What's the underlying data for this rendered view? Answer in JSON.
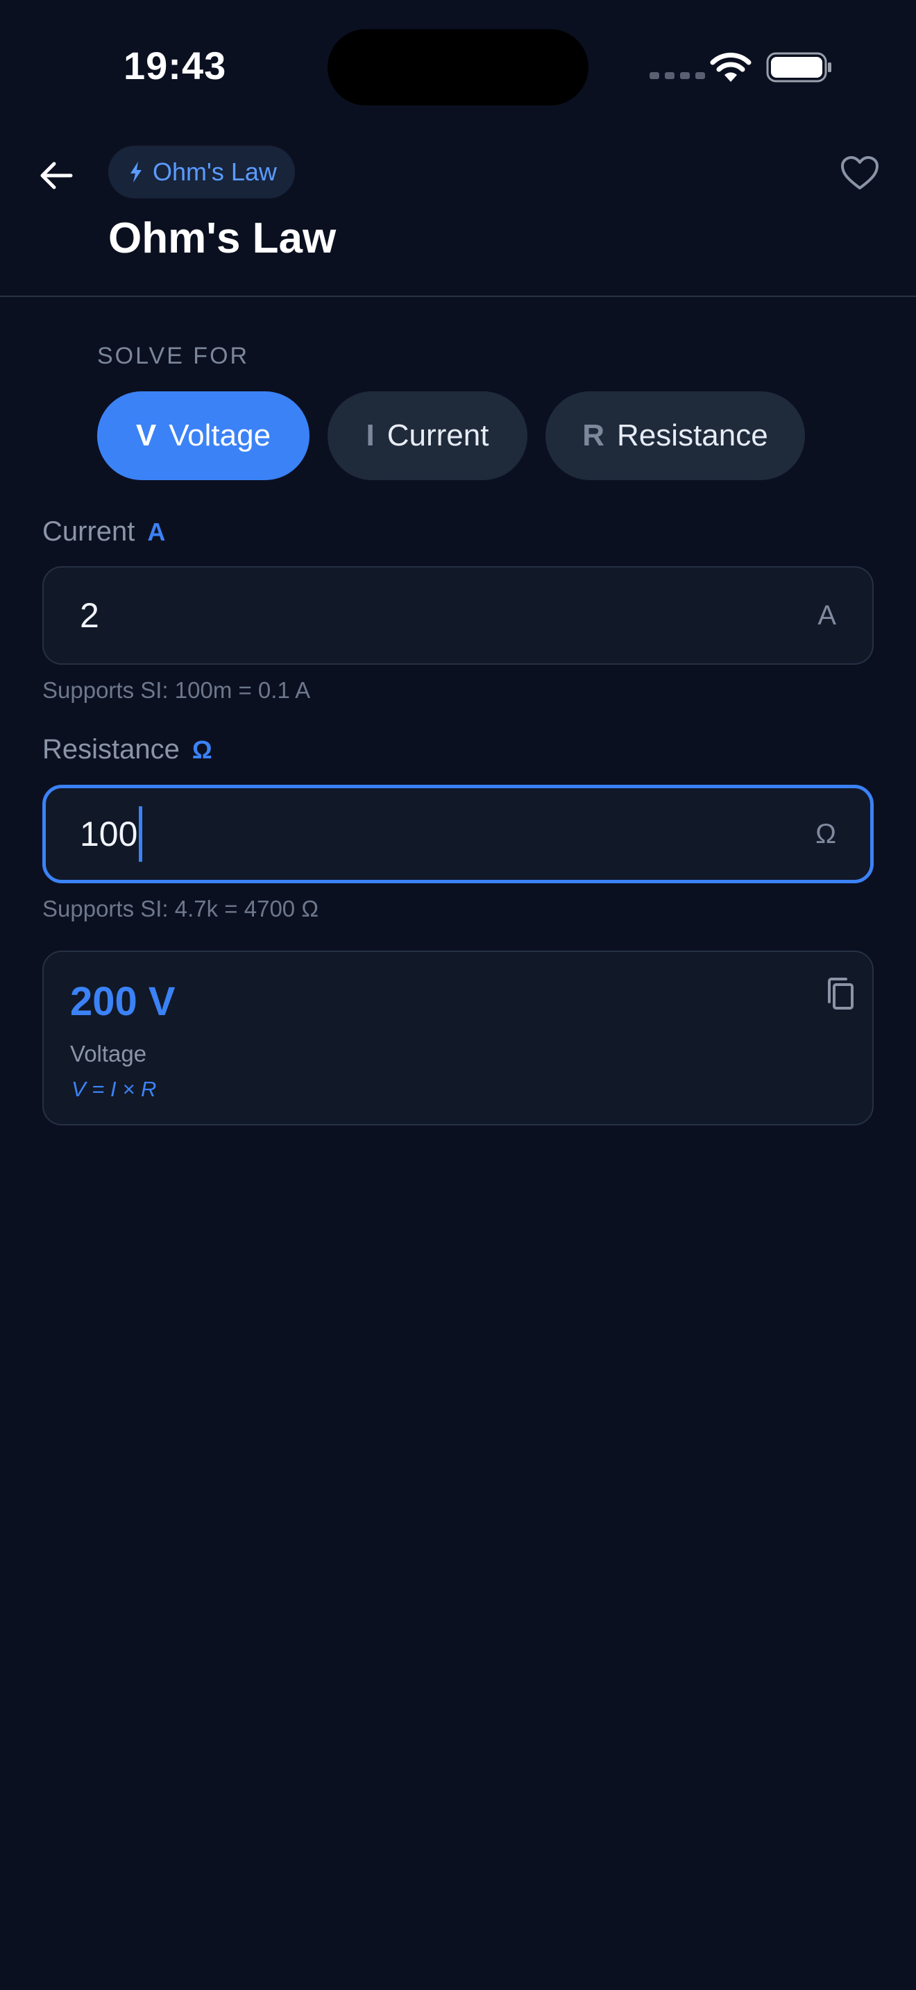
{
  "status_bar": {
    "time": "19:43"
  },
  "header": {
    "category_chip": "Ohm's Law",
    "title": "Ohm's Law"
  },
  "solve_for": {
    "label": "SOLVE FOR",
    "options": [
      {
        "letter": "V",
        "label": "Voltage",
        "selected": true
      },
      {
        "letter": "I",
        "label": "Current",
        "selected": false
      },
      {
        "letter": "R",
        "label": "Resistance",
        "selected": false
      }
    ]
  },
  "fields": [
    {
      "label": "Current",
      "unit": "A",
      "value": "2",
      "suffix": "A",
      "hint": "Supports SI: 100m = 0.1 A",
      "focused": false
    },
    {
      "label": "Resistance",
      "unit": "Ω",
      "value": "100",
      "suffix": "Ω",
      "hint": "Supports SI: 4.7k = 4700 Ω",
      "focused": true
    }
  ],
  "result": {
    "value": "200 V",
    "label": "Voltage",
    "formula": "V = I × R"
  },
  "colors": {
    "background": "#0b1020",
    "accent": "#3b82f6",
    "surface": "#111827",
    "segment_inactive": "#1f2a3b"
  },
  "icons": {
    "back": "arrow-left-icon",
    "chip": "bolt-icon",
    "favorite": "heart-icon",
    "copy": "copy-icon"
  }
}
